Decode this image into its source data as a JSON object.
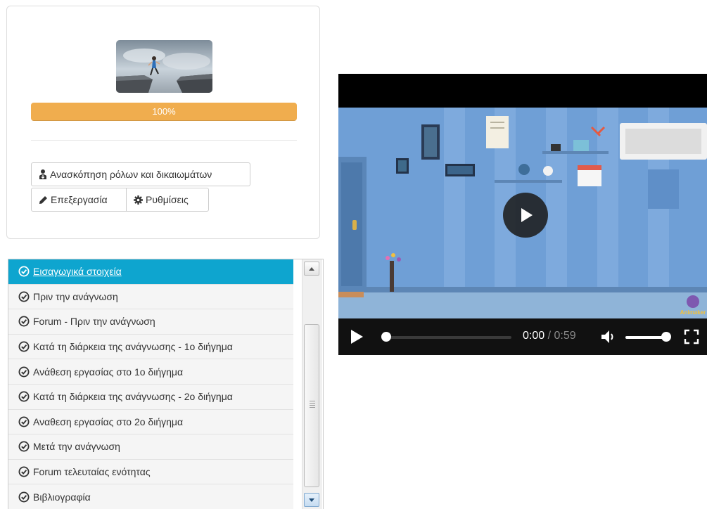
{
  "course": {
    "thumbnail_icon": "cliff-jump-image",
    "progress_value": 100,
    "progress_label": "100%",
    "progress_color": "#f0ad4e",
    "buttons": {
      "roles_label": "Ανασκόπηση ρόλων και δικαιωμάτων",
      "edit_label": "Επεξεργασία",
      "settings_label": "Ρυθμίσεις"
    }
  },
  "units": {
    "active_color": "#0ea5cf",
    "items": [
      {
        "label": "Εισαγωγικά στοιχεία",
        "active": true
      },
      {
        "label": "Πριν την ανάγνωση",
        "active": false
      },
      {
        "label": "Forum - Πριν την ανάγνωση",
        "active": false
      },
      {
        "label": "Κατά τη διάρκεια της ανάγνωσης - 1ο διήγημα",
        "active": false
      },
      {
        "label": "Ανάθεση εργασίας στο 1ο διήγημα",
        "active": false
      },
      {
        "label": "Κατά τη διάρκεια της ανάγνωσης - 2ο διήγημα",
        "active": false
      },
      {
        "label": "Αναθεση εργασίας στο 2ο διήγημα",
        "active": false
      },
      {
        "label": "Μετά την ανάγνωση",
        "active": false
      },
      {
        "label": "Forum τελευταίας ενότητας",
        "active": false
      },
      {
        "label": "Βιβλιογραφία",
        "active": false
      }
    ]
  },
  "video": {
    "current_time": "0:00",
    "separator": "/",
    "duration": "0:59",
    "seek_fraction": 0,
    "volume_fraction": 1,
    "watermark_text": "Animaker"
  }
}
